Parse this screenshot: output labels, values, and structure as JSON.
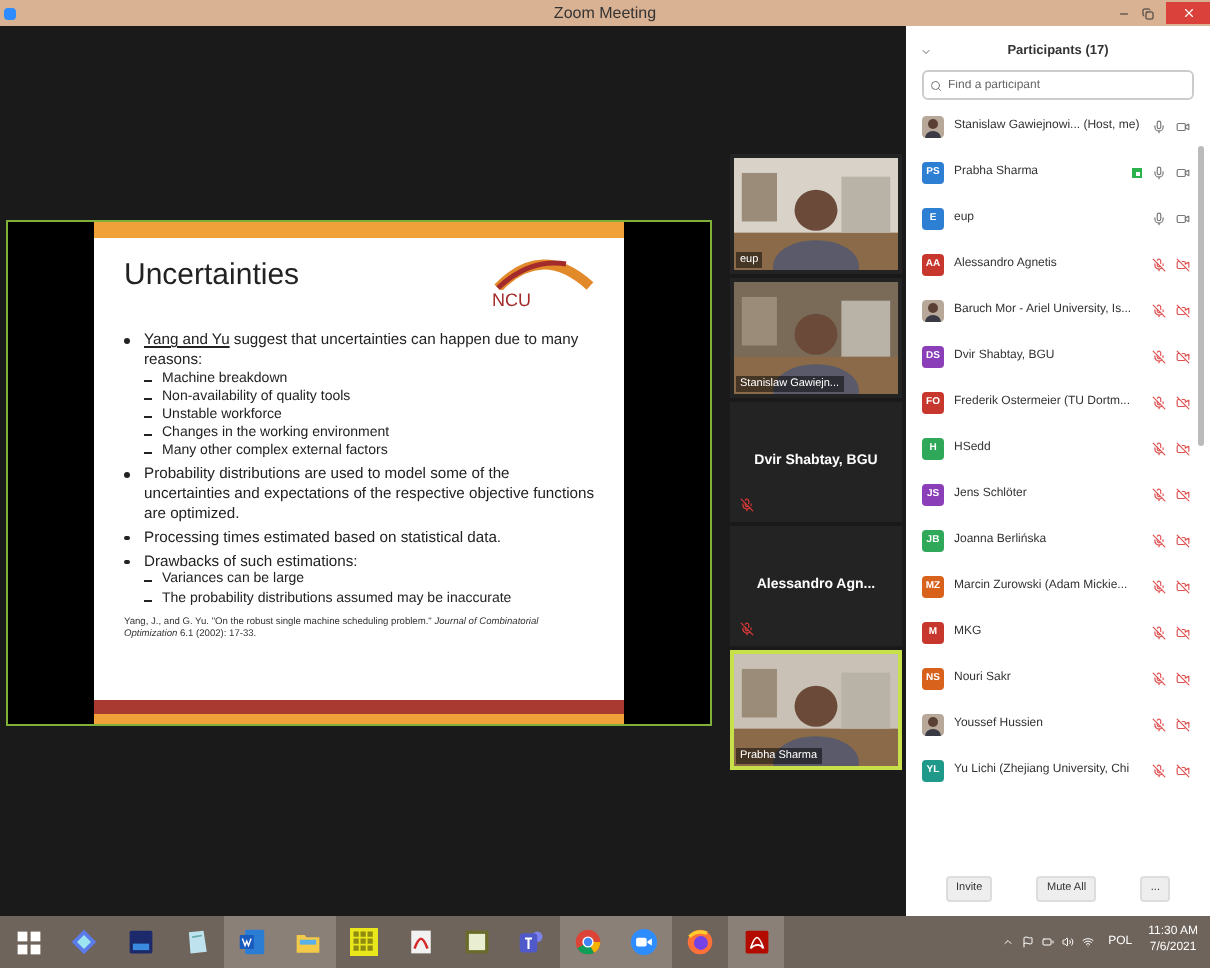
{
  "window": {
    "title": "Zoom Meeting"
  },
  "slide": {
    "title": "Uncertainties",
    "logo": "NCU",
    "bullets": [
      {
        "link": "Yang and Yu",
        "text": " suggest that uncertainties can happen due to many reasons:",
        "children": [
          "Machine breakdown",
          "Non-availability of quality tools",
          "Unstable workforce",
          "Changes in the working environment",
          "Many other complex external factors"
        ]
      },
      {
        "text": "Probability distributions are used to model some of the uncertainties and expectations of the respective objective functions are optimized."
      },
      {
        "text": "Processing times estimated based on statistical data."
      },
      {
        "text": "Drawbacks of such estimations:",
        "children": [
          "Variances can be large",
          "The probability distributions assumed may be inaccurate"
        ]
      }
    ],
    "citation": "Yang, J., and G. Yu. \"On the robust single machine scheduling problem.\" *Journal of Combinatorial Optimization* 6.1 (2002): 17-33."
  },
  "videos": [
    {
      "kind": "camera",
      "name": "eup",
      "muted": false,
      "selected": false
    },
    {
      "kind": "camera",
      "name": "Stanislaw Gawiejn...",
      "muted": false,
      "selected": false
    },
    {
      "kind": "name",
      "name": "Dvir Shabtay, BGU",
      "muted": true,
      "selected": false
    },
    {
      "kind": "name",
      "name": "Alessandro  Agn...",
      "muted": true,
      "selected": false
    },
    {
      "kind": "camera",
      "name": "Prabha Sharma",
      "muted": false,
      "selected": true
    }
  ],
  "participants_panel": {
    "title": "Participants (17)",
    "search": {
      "placeholder": "Find a participant"
    },
    "participants": [
      {
        "name": "Stanislaw Gawiejnowi... (Host, me)",
        "muted": false,
        "video_off": false,
        "sharing": false
      },
      {
        "kind": "initials",
        "initials": "PS",
        "color": "#2d7fd3",
        "name": "Prabha Sharma",
        "muted": false,
        "video_off": false,
        "sharing": true
      },
      {
        "kind": "initials",
        "initials": "E",
        "color": "#2d7fd3",
        "name": "eup",
        "muted": false,
        "video_off": false,
        "sharing": false
      },
      {
        "kind": "initials",
        "initials": "AA",
        "color": "#c8372d",
        "name": "Alessandro Agnetis",
        "muted": true,
        "video_off": true,
        "sharing": false
      },
      {
        "name": "Baruch Mor - Ariel University, Is...",
        "muted": true,
        "video_off": true,
        "sharing": false
      },
      {
        "kind": "initials",
        "initials": "DS",
        "color": "#8a3fb8",
        "name": "Dvir Shabtay, BGU",
        "muted": true,
        "video_off": true,
        "sharing": false
      },
      {
        "kind": "initials",
        "initials": "FO",
        "color": "#c8372d",
        "name": "Frederik Ostermeier (TU Dortm...",
        "muted": true,
        "video_off": true,
        "sharing": false
      },
      {
        "kind": "initials",
        "initials": "H",
        "color": "#2fa85a",
        "name": "HSedd",
        "muted": true,
        "video_off": true,
        "sharing": false
      },
      {
        "kind": "initials",
        "initials": "JS",
        "color": "#8a3fb8",
        "name": "Jens Schlöter",
        "muted": true,
        "video_off": true,
        "sharing": false
      },
      {
        "kind": "initials",
        "initials": "JB",
        "color": "#2fa85a",
        "name": "Joanna Berlińska",
        "muted": true,
        "video_off": true,
        "sharing": false
      },
      {
        "kind": "initials",
        "initials": "MZ",
        "color": "#d8611c",
        "name": "Marcin Zurowski (Adam Mickie...",
        "muted": true,
        "video_off": true,
        "sharing": false
      },
      {
        "kind": "initials",
        "initials": "M",
        "color": "#c8372d",
        "name": "MKG",
        "muted": true,
        "video_off": true,
        "sharing": false
      },
      {
        "kind": "initials",
        "initials": "NS",
        "color": "#d8611c",
        "name": "Nouri Sakr",
        "muted": true,
        "video_off": true,
        "sharing": false
      },
      {
        "name": "Youssef Hussien",
        "muted": true,
        "video_off": true,
        "sharing": false
      },
      {
        "kind": "initials",
        "initials": "YL",
        "color": "#1f9a8a",
        "name": "Yu Lichi (Zhejiang University, Chi",
        "muted": true,
        "video_off": true,
        "sharing": false
      }
    ],
    "buttons": [
      "Invite",
      "Mute All",
      "..."
    ]
  },
  "taskbar": {
    "apps": [
      {
        "kind": "start",
        "active": false
      },
      {
        "kind": "diamond",
        "active": false
      },
      {
        "kind": "dev",
        "active": false
      },
      {
        "kind": "notepad",
        "active": false
      },
      {
        "kind": "word",
        "active": true
      },
      {
        "kind": "folder",
        "active": true
      },
      {
        "kind": "grid",
        "active": false
      },
      {
        "kind": "pdf",
        "active": false
      },
      {
        "kind": "fxc",
        "active": false
      },
      {
        "kind": "teams",
        "active": false
      },
      {
        "kind": "chrome",
        "active": true
      },
      {
        "kind": "zoom",
        "active": true
      },
      {
        "kind": "firefox",
        "active": false
      },
      {
        "kind": "acrobat",
        "active": true
      }
    ],
    "language": "POL",
    "time": "11:30 AM",
    "date": "7/6/2021"
  }
}
